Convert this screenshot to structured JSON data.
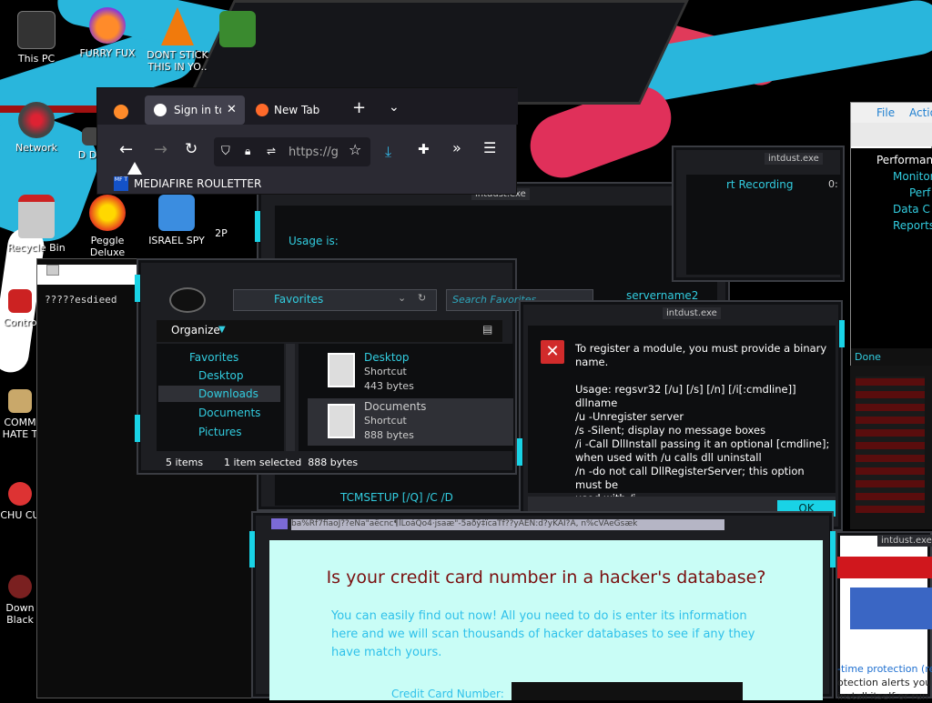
{
  "desktop": {
    "icons": [
      {
        "label": "This PC"
      },
      {
        "label": "FURRY FUX"
      },
      {
        "label": "DONT STICK THIS IN YO.."
      },
      {
        "label": "Network"
      },
      {
        "label": "D DU"
      },
      {
        "label": "Recycle Bin"
      },
      {
        "label": "Peggle Deluxe"
      },
      {
        "label": "ISRAEL SPY"
      },
      {
        "label": "2P"
      },
      {
        "label": "Contro"
      },
      {
        "label": "COMM HATE T"
      },
      {
        "label": "CHU CU"
      },
      {
        "label": "Down Black"
      }
    ]
  },
  "browser": {
    "tab_active": "Sign in to",
    "tab_new": "New Tab",
    "url": "https://g",
    "bookmark": "MEDIAFIRE ROULETTER",
    "bookmark_badge": "MF T"
  },
  "usage_window": {
    "title": "intdust.exe",
    "usage_label": "Usage is:",
    "servername": "servername2",
    "tcm": "TCMSETUP [/Q] /C /D"
  },
  "right_mini": {
    "title": "intdust.exe",
    "recording": "rt Recording",
    "zero": "0:"
  },
  "explorer": {
    "address": "Favorites",
    "search_placeholder": "Search Favorites",
    "organize": "Organize",
    "nav": [
      "Favorites",
      "Desktop",
      "Downloads",
      "Documents",
      "Pictures"
    ],
    "files": [
      {
        "name": "Desktop",
        "type": "Shortcut",
        "size": "443 bytes"
      },
      {
        "name": "Documents",
        "type": "Shortcut",
        "size": "888 bytes"
      }
    ],
    "status_items": "5 items",
    "status_selected": "1 item selected  888 bytes"
  },
  "cmd": {
    "text": "?????esdieed"
  },
  "error_dialog": {
    "title": "intdust.exe",
    "line1": "To register a module, you must provide a binary",
    "line2": "name.",
    "usage": "Usage: regsvr32 [/u] [/s] [/n] [/i[:cmdline]] dllname",
    "u": "/u -Unregister server",
    "s": "/s -Silent; display no message boxes",
    "i1": "/i -Call DllInstall passing it an optional [cmdline];",
    "i2": "when used with /u calls dll uninstall",
    "n1": "/n -do not call DllRegisterServer; this option must be",
    "n2": "used with /i",
    "ok": "OK"
  },
  "perfmon": {
    "menu_file": "File",
    "menu_action": "Actio",
    "tree": [
      "Performance",
      "Monitor",
      "Perf",
      "Data C",
      "Reports"
    ],
    "status": "Done"
  },
  "scam": {
    "title_bar": "ba%Rf7fiaoJ??eNa\"aëcnc¶lLoáQo4·jsaæ\"-5aðÿ‡ïcaTf??yAEN:d?yKAI?A, n%cVAeGsæk",
    "headline": "Is your credit card number in a hacker's database?",
    "body": "You can easily find out now! All you need to do is enter its information here and we will scan thousands of hacker databases to see if any they have match yours.",
    "cc_label": "Credit Card Number:"
  },
  "right_bottom": {
    "title": "intdust.exe",
    "protection": "-time protection (re",
    "line2": "otection alerts you w",
    "line3": "install itself or run o"
  }
}
